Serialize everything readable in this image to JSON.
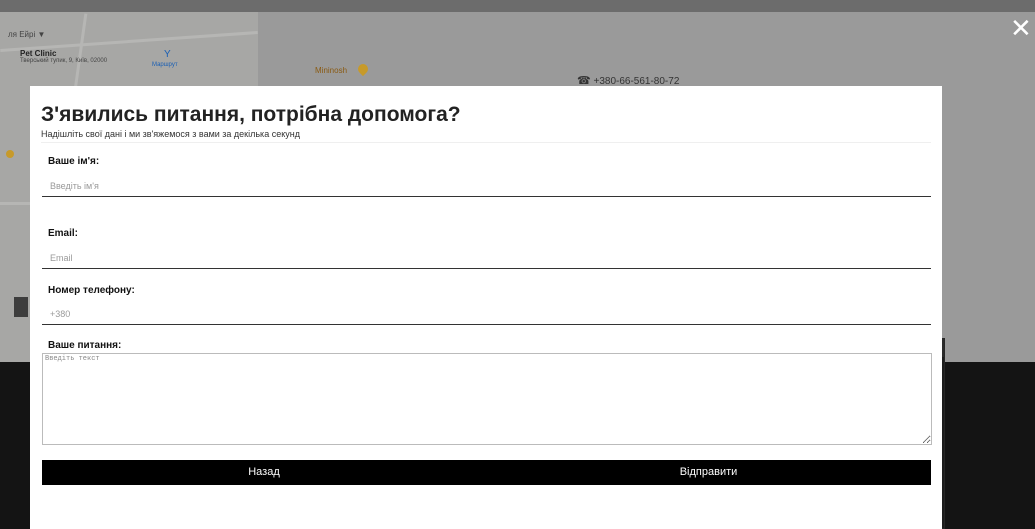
{
  "background": {
    "map": {
      "top_line": "ля Ейрі ▼",
      "place_title": "Pet Clinic",
      "place_address": "Тверський тупик, 9, Київ, 02000",
      "branch_label": "Маршрут",
      "poi_label": "Mininosh"
    },
    "phone": "+380-66-561-80-72",
    "close_symbol": "✕"
  },
  "modal": {
    "title": "З'явились питання, потрібна допомога?",
    "subtitle": "Надішліть свої дані і ми зв'яжемося з вами за декілька секунд",
    "fields": {
      "name": {
        "label": "Ваше ім'я:",
        "placeholder": "Введіть ім'я",
        "value": ""
      },
      "email": {
        "label": "Email:",
        "placeholder": "Email",
        "value": ""
      },
      "phone": {
        "label": "Номер телефону:",
        "placeholder": "+380",
        "value": ""
      },
      "question": {
        "label": "Ваше питання:",
        "placeholder": "Введіть текст",
        "value": ""
      }
    },
    "buttons": {
      "back": "Назад",
      "send": "Відправити"
    }
  }
}
